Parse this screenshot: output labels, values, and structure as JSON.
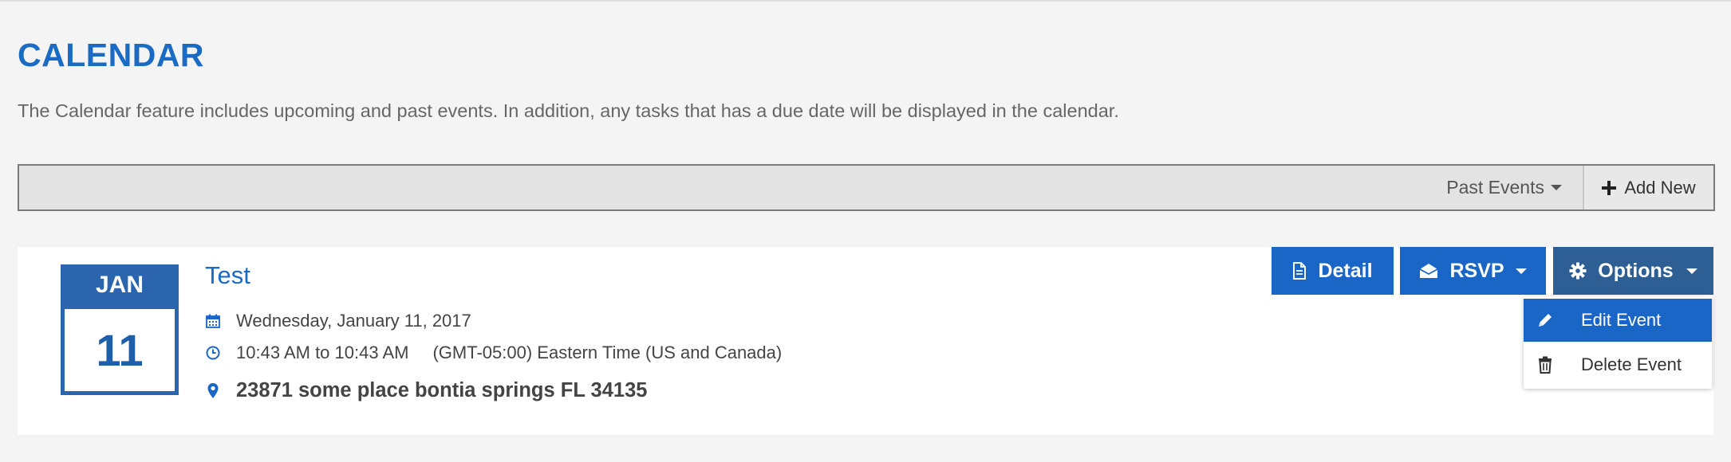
{
  "header": {
    "title": "CALENDAR",
    "description": "The Calendar feature includes upcoming and past events. In addition, any tasks that has a due date will be displayed in the calendar."
  },
  "toolbar": {
    "filter_label": "Past Events",
    "add_new_label": "Add New"
  },
  "event": {
    "month": "JAN",
    "day": "11",
    "title": "Test",
    "date": "Wednesday, January 11, 2017",
    "time": "10:43 AM to 10:43 AM",
    "timezone": "(GMT-05:00) Eastern Time (US and Canada)",
    "location": "23871 some place bontia springs FL 34135"
  },
  "actions": {
    "detail_label": "Detail",
    "rsvp_label": "RSVP",
    "options_label": "Options"
  },
  "options_menu": {
    "items": [
      {
        "label": "Edit Event",
        "icon": "pencil-icon",
        "active": true
      },
      {
        "label": "Delete Event",
        "icon": "trash-icon",
        "active": false
      }
    ]
  },
  "colors": {
    "accent": "#1a66c6",
    "options_button": "#2d5e94",
    "date_box": "#2a65ad",
    "background": "#f4f4f4"
  }
}
